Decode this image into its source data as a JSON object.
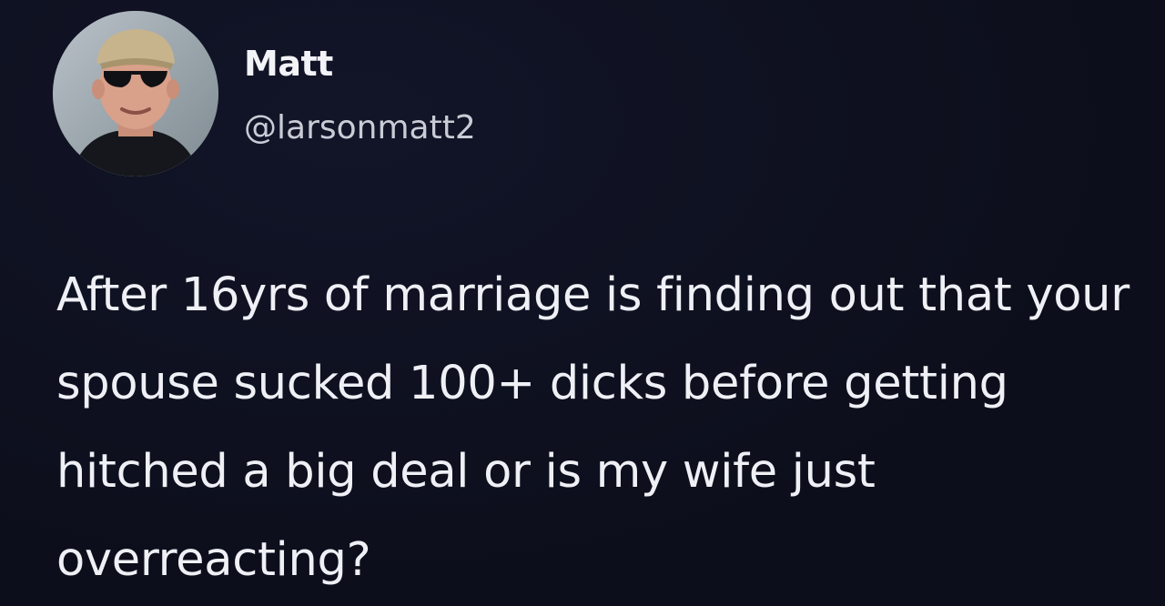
{
  "tweet": {
    "author": {
      "display_name": "Matt",
      "handle": "@larsonmatt2",
      "avatar_icon": "profile-photo-icon"
    },
    "body": "After 16yrs of marriage is finding out that your spouse sucked 100+ dicks before getting hitched a big deal or is my wife just overreacting?"
  },
  "colors": {
    "background": "#0d0f1d",
    "text_primary": "#eef0f5",
    "text_secondary": "#c9ccd6"
  }
}
